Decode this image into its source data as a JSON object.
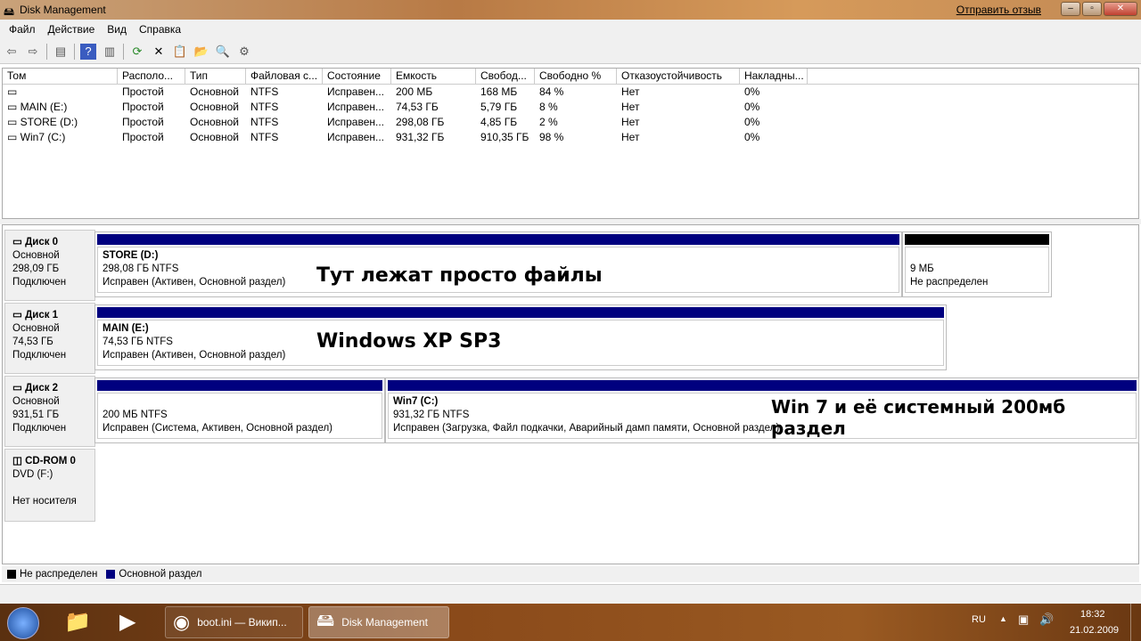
{
  "window": {
    "title": "Disk Management",
    "feedback": "Отправить отзыв"
  },
  "menu": [
    "Файл",
    "Действие",
    "Вид",
    "Справка"
  ],
  "table": {
    "headers": [
      "Том",
      "Располо...",
      "Тип",
      "Файловая с...",
      "Состояние",
      "Емкость",
      "Свобод...",
      "Свободно %",
      "Отказоустойчивость",
      "Накладны..."
    ],
    "rows": [
      [
        "",
        "Простой",
        "Основной",
        "NTFS",
        "Исправен...",
        "200 МБ",
        "168 МБ",
        "84 %",
        "Нет",
        "0%"
      ],
      [
        "MAIN (E:)",
        "Простой",
        "Основной",
        "NTFS",
        "Исправен...",
        "74,53 ГБ",
        "5,79 ГБ",
        "8 %",
        "Нет",
        "0%"
      ],
      [
        "STORE (D:)",
        "Простой",
        "Основной",
        "NTFS",
        "Исправен...",
        "298,08 ГБ",
        "4,85 ГБ",
        "2 %",
        "Нет",
        "0%"
      ],
      [
        "Win7 (C:)",
        "Простой",
        "Основной",
        "NTFS",
        "Исправен...",
        "931,32 ГБ",
        "910,35 ГБ",
        "98 %",
        "Нет",
        "0%"
      ]
    ]
  },
  "disks": [
    {
      "name": "Диск 0",
      "type": "Основной",
      "size": "298,09 ГБ",
      "status": "Подключен",
      "parts": [
        {
          "name": "STORE  (D:)",
          "size": "298,08 ГБ NTFS",
          "status": "Исправен (Активен, Основной раздел)"
        },
        {
          "name": "",
          "size": "9 МБ",
          "status": "Не распределен"
        }
      ],
      "note": "Тут лежат просто файлы"
    },
    {
      "name": "Диск 1",
      "type": "Основной",
      "size": "74,53 ГБ",
      "status": "Подключен",
      "parts": [
        {
          "name": "MAIN  (E:)",
          "size": "74,53 ГБ NTFS",
          "status": "Исправен (Активен, Основной раздел)"
        }
      ],
      "note": "Windows XP SP3"
    },
    {
      "name": "Диск 2",
      "type": "Основной",
      "size": "931,51 ГБ",
      "status": "Подключен",
      "parts": [
        {
          "name": "",
          "size": "200 МБ NTFS",
          "status": "Исправен (Система, Активен, Основной раздел)"
        },
        {
          "name": "Win7  (C:)",
          "size": "931,32 ГБ NTFS",
          "status": "Исправен (Загрузка, Файл подкачки, Аварийный дамп памяти, Основной раздел)"
        }
      ],
      "note": "Win 7 и её системный 200мб раздел"
    },
    {
      "name": "CD-ROM 0",
      "type": "DVD (F:)",
      "status": "Нет носителя"
    }
  ],
  "legend": {
    "unallocated": "Не распределен",
    "primary": "Основной раздел",
    "colors": {
      "unallocated": "#000000",
      "primary": "#00007f"
    }
  },
  "taskbar": {
    "items": [
      "boot.ini — Викип...",
      "Disk Management"
    ],
    "lang": "RU",
    "time": "18:32",
    "date": "21.02.2009"
  }
}
